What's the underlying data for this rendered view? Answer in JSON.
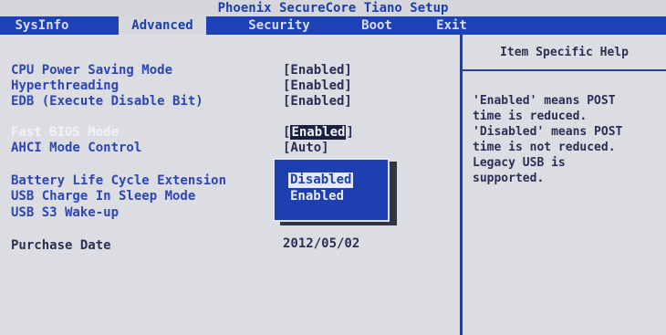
{
  "window": {
    "title": "Phoenix SecureCore Tiano Setup"
  },
  "menu": {
    "tabs": [
      {
        "label": "SysInfo"
      },
      {
        "label": "Advanced"
      },
      {
        "label": "Security"
      },
      {
        "label": "Boot"
      },
      {
        "label": "Exit"
      }
    ],
    "active": "Advanced"
  },
  "settings": [
    {
      "label": "CPU Power Saving Mode",
      "value": "[Enabled]"
    },
    {
      "label": "Hyperthreading",
      "value": "[Enabled]"
    },
    {
      "label": "EDB (Execute Disable Bit)",
      "value": "[Enabled]"
    },
    {
      "label": "Fast BIOS Mode",
      "value": "[Enabled]",
      "value_highlight": "Enabled",
      "value_open": "[",
      "value_close": "]"
    },
    {
      "label": "AHCI Mode Control",
      "value": "[Auto]"
    },
    {
      "label": "Battery Life Cycle Extension",
      "value": ""
    },
    {
      "label": "USB Charge In Sleep Mode",
      "value": ""
    },
    {
      "label": "USB S3 Wake-up",
      "value": ""
    },
    {
      "label": "Purchase Date",
      "value": "2012/05/02"
    }
  ],
  "popup": {
    "options": [
      {
        "label": "Disabled",
        "selected": true
      },
      {
        "label": "Enabled",
        "selected": false
      }
    ]
  },
  "help": {
    "title": "Item Specific Help",
    "text": "'Enabled' means POST\ntime is reduced.\n'Disabled' means POST\ntime is not reduced.\nLegacy USB is\nsupported."
  },
  "colors": {
    "menu_bar": "#1d42b8",
    "background": "#dcdde2",
    "label_blue": "#2d46b4",
    "popup_bg": "#1d3fb0"
  }
}
